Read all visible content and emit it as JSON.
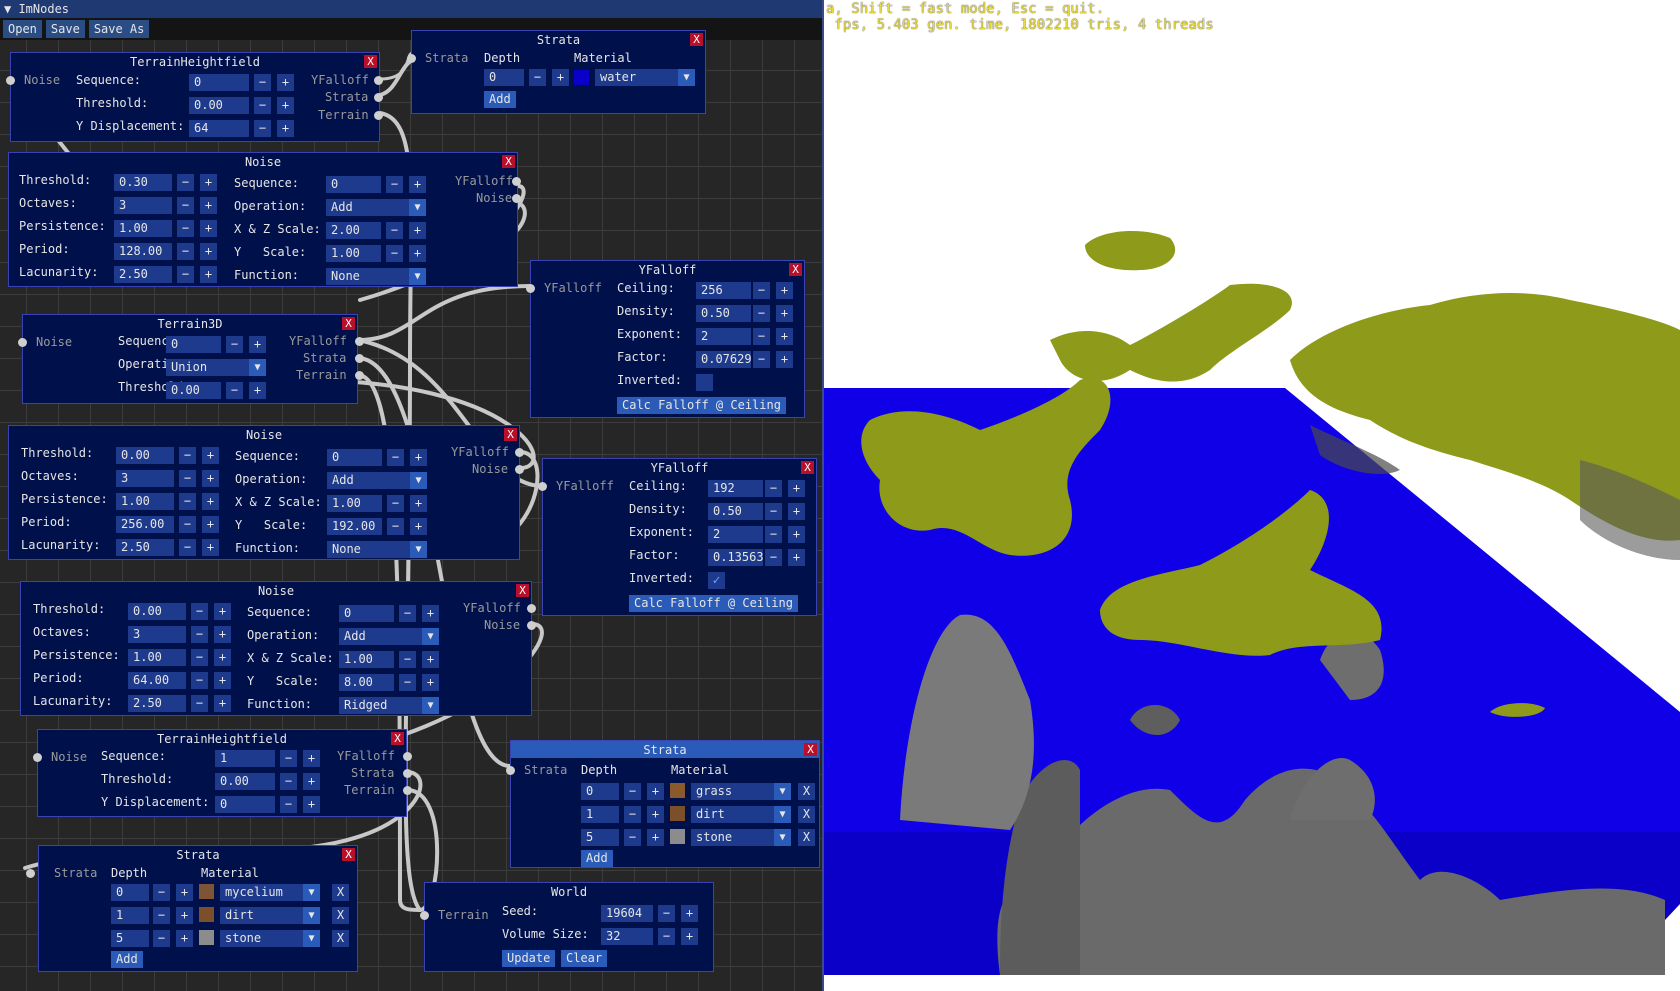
{
  "status_text": "a, Shift = fast mode, Esc = quit.\n fps, 5.403 gen. time, 1802210 tris, 4 threads",
  "window": {
    "title": "ImNodes",
    "menu": [
      "Open",
      "Save",
      "Save As"
    ]
  },
  "common": {
    "minus": "−",
    "plus": "+",
    "close": "X",
    "arrow": "▼",
    "add": "Add",
    "calc": "Calc Falloff @ Ceiling",
    "check": "✓"
  },
  "nodes": {
    "th1": {
      "title": "TerrainHeightfield",
      "in_noise": "Noise",
      "out": [
        "YFalloff",
        "Strata",
        "Terrain"
      ],
      "rows": [
        {
          "label": "Sequence:",
          "value": "0"
        },
        {
          "label": "Threshold:",
          "value": "0.00"
        },
        {
          "label": "Y Displacement:",
          "value": "64"
        }
      ]
    },
    "strata_water": {
      "title": "Strata",
      "in": "Strata",
      "cols": [
        "Depth",
        "Material"
      ],
      "depth": "0",
      "material": "water",
      "add": "Add"
    },
    "noise1": {
      "title": "Noise",
      "out": [
        "YFalloff",
        "Noise"
      ],
      "left": [
        {
          "label": "Threshold:",
          "value": "0.30"
        },
        {
          "label": "Octaves:",
          "value": "3"
        },
        {
          "label": "Persistence:",
          "value": "1.00"
        },
        {
          "label": "Period:",
          "value": "128.00"
        },
        {
          "label": "Lacunarity:",
          "value": "2.50"
        }
      ],
      "right": [
        {
          "label": "Sequence:",
          "value": "0"
        },
        {
          "label": "Operation:",
          "value": "Add"
        },
        {
          "label": "X & Z Scale:",
          "value": "2.00"
        },
        {
          "label": "Y   Scale:",
          "value": "1.00"
        },
        {
          "label": "Function:",
          "value": "None"
        }
      ]
    },
    "yf1": {
      "title": "YFalloff",
      "in": "YFalloff",
      "rows": [
        {
          "label": "Ceiling:",
          "value": "256"
        },
        {
          "label": "Density:",
          "value": "0.50"
        },
        {
          "label": "Exponent:",
          "value": "2"
        },
        {
          "label": "Factor:",
          "value": "0.07629"
        }
      ],
      "inverted": "Inverted:",
      "calc": "Calc Falloff @ Ceiling"
    },
    "t3d": {
      "title": "Terrain3D",
      "in_noise": "Noise",
      "out": [
        "YFalloff",
        "Strata",
        "Terrain"
      ],
      "seq_label": "Sequence:",
      "seq": "0",
      "op_label": "Operation:",
      "op": "Union",
      "thr_label": "Threshold:",
      "thr": "0.00"
    },
    "noise2": {
      "title": "Noise",
      "out": [
        "YFalloff",
        "Noise"
      ],
      "left": [
        {
          "label": "Threshold:",
          "value": "0.00"
        },
        {
          "label": "Octaves:",
          "value": "3"
        },
        {
          "label": "Persistence:",
          "value": "1.00"
        },
        {
          "label": "Period:",
          "value": "256.00"
        },
        {
          "label": "Lacunarity:",
          "value": "2.50"
        }
      ],
      "right": [
        {
          "label": "Sequence:",
          "value": "0"
        },
        {
          "label": "Operation:",
          "value": "Add"
        },
        {
          "label": "X & Z Scale:",
          "value": "1.00"
        },
        {
          "label": "Y   Scale:",
          "value": "192.00"
        },
        {
          "label": "Function:",
          "value": "None"
        }
      ]
    },
    "yf2": {
      "title": "YFalloff",
      "in": "YFalloff",
      "rows": [
        {
          "label": "Ceiling:",
          "value": "192"
        },
        {
          "label": "Density:",
          "value": "0.50"
        },
        {
          "label": "Exponent:",
          "value": "2"
        },
        {
          "label": "Factor:",
          "value": "0.13563"
        }
      ],
      "inverted": "Inverted:",
      "calc": "Calc Falloff @ Ceiling"
    },
    "noise3": {
      "title": "Noise",
      "out": [
        "YFalloff",
        "Noise"
      ],
      "left": [
        {
          "label": "Threshold:",
          "value": "0.00"
        },
        {
          "label": "Octaves:",
          "value": "3"
        },
        {
          "label": "Persistence:",
          "value": "1.00"
        },
        {
          "label": "Period:",
          "value": "64.00"
        },
        {
          "label": "Lacunarity:",
          "value": "2.50"
        }
      ],
      "right": [
        {
          "label": "Sequence:",
          "value": "0"
        },
        {
          "label": "Operation:",
          "value": "Add"
        },
        {
          "label": "X & Z Scale:",
          "value": "1.00"
        },
        {
          "label": "Y   Scale:",
          "value": "8.00"
        },
        {
          "label": "Function:",
          "value": "Ridged"
        }
      ]
    },
    "th2": {
      "title": "TerrainHeightfield",
      "in_noise": "Noise",
      "out": [
        "YFalloff",
        "Strata",
        "Terrain"
      ],
      "rows": [
        {
          "label": "Sequence:",
          "value": "1"
        },
        {
          "label": "Threshold:",
          "value": "0.00"
        },
        {
          "label": "Y Displacement:",
          "value": "0"
        }
      ]
    },
    "strata_mid": {
      "title": "Strata",
      "in": "Strata",
      "cols": [
        "Depth",
        "Material"
      ],
      "rows": [
        {
          "depth": "0",
          "material": "grass",
          "color": "#8a5a2b"
        },
        {
          "depth": "1",
          "material": "dirt",
          "color": "#7a4f2a"
        },
        {
          "depth": "5",
          "material": "stone",
          "color": "#8c8c8c"
        }
      ],
      "add": "Add"
    },
    "strata_bot": {
      "title": "Strata",
      "in": "Strata",
      "cols": [
        "Depth",
        "Material"
      ],
      "rows": [
        {
          "depth": "0",
          "material": "mycelium",
          "color": "#7d5536"
        },
        {
          "depth": "1",
          "material": "dirt",
          "color": "#7a4f2a"
        },
        {
          "depth": "5",
          "material": "stone",
          "color": "#8c8c8c"
        }
      ],
      "add": "Add"
    },
    "world": {
      "title": "World",
      "in": "Terrain",
      "seed_label": "Seed:",
      "seed": "19604",
      "vol_label": "Volume Size:",
      "vol": "32",
      "update": "Update",
      "clear": "Clear"
    }
  },
  "colors": {
    "water": "#0a00ff",
    "grass": "#8d9a1a",
    "stone": "#6e6e6e",
    "node_bg": "#00104a",
    "wire": "#c8c8c8"
  }
}
